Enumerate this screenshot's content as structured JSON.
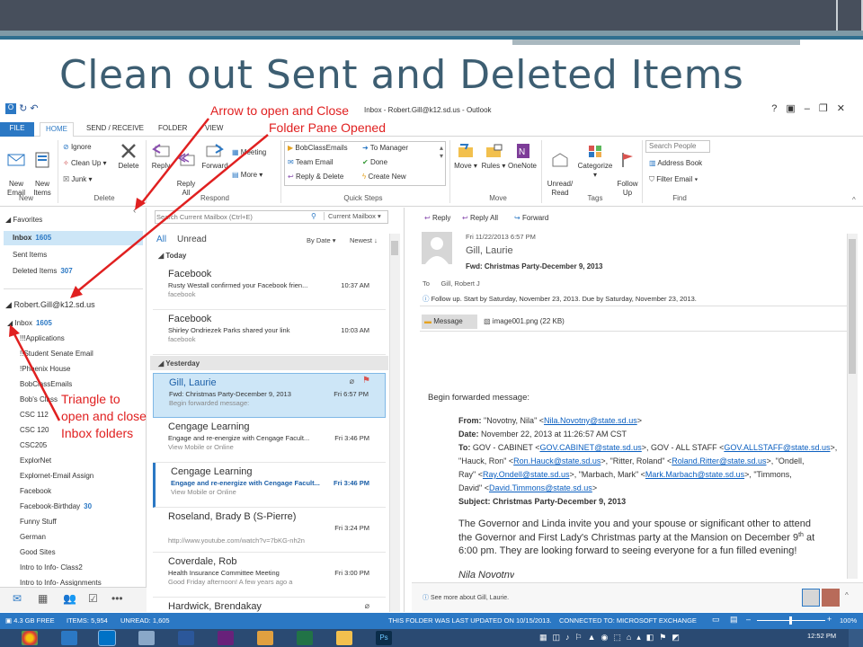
{
  "slide": {
    "title": "Clean out Sent and Deleted Items"
  },
  "window": {
    "title": "Inbox - Robert.Gill@k12.sd.us - Outlook"
  },
  "tabs": [
    "FILE",
    "HOME",
    "SEND / RECEIVE",
    "FOLDER",
    "VIEW"
  ],
  "ribbon": {
    "new_email": "New\nEmail",
    "new_items": "New\nItems",
    "ignore": "Ignore",
    "clean_up": "Clean Up",
    "junk": "Junk",
    "delete": "Delete",
    "reply": "Reply",
    "reply_all": "Reply\nAll",
    "forward": "Forward",
    "meeting": "Meeting",
    "more": "More",
    "qs_bobclass": "BobClassEmails",
    "qs_team": "Team Email",
    "qs_replydelete": "Reply & Delete",
    "qs_manager": "To Manager",
    "qs_done": "Done",
    "qs_createnew": "Create New",
    "move": "Move",
    "rules": "Rules",
    "onenote": "OneNote",
    "unread_read": "Unread/\nRead",
    "categorize": "Categorize",
    "follow_up": "Follow\nUp",
    "search_people": "Search People",
    "address_book": "Address Book",
    "filter_email": "Filter Email",
    "groups": [
      "New",
      "Delete",
      "Respond",
      "Quick Steps",
      "Move",
      "Tags",
      "Find"
    ]
  },
  "folders": {
    "favorites_label": "Favorites",
    "fav_inbox": "Inbox",
    "fav_inbox_count": "1605",
    "sent": "Sent Items",
    "deleted": "Deleted Items",
    "deleted_count": "307",
    "account": "Robert.Gill@k12.sd.us",
    "inbox": "Inbox",
    "inbox_count": "1605",
    "subfolders": [
      "!!!Applications",
      "!!Student Senate Email",
      "!Phoenix House",
      "BobClassEmails",
      "Bob's Class",
      "CSC 112",
      "CSC 120",
      "CSC205",
      "ExplorNet",
      "Explornet-Email Assign",
      "Facebook",
      "Facebook-Birthday",
      "Funny Stuff",
      "German",
      "Good Sites",
      "Intro to Info- Class2",
      "Intro to Info- Assignments"
    ],
    "fb_birthday_count": "30"
  },
  "list": {
    "search_placeholder": "Search Current Mailbox (Ctrl+E)",
    "scope": "Current Mailbox",
    "all": "All",
    "unread": "Unread",
    "by_date": "By Date",
    "newest": "Newest",
    "today": "Today",
    "yesterday": "Yesterday",
    "messages": [
      {
        "sender": "Facebook",
        "subject": "Rusty Westall confirmed your Facebook frien...",
        "preview": "facebook",
        "time": "10:37 AM"
      },
      {
        "sender": "Facebook",
        "subject": "Shirley Ondriezek Parks shared your link",
        "preview": "facebook",
        "time": "10:03 AM"
      },
      {
        "sender": "Gill, Laurie",
        "subject": "Fwd: Christmas Party-December 9, 2013",
        "preview": "Begin forwarded message:",
        "time": "Fri 6:57 PM"
      },
      {
        "sender": "Cengage Learning",
        "subject": "Engage and re-energize with Cengage Facult...",
        "preview": "View Mobile or Online",
        "time": "Fri 3:46 PM"
      },
      {
        "sender": "Cengage Learning",
        "subject": "Engage and re-energize with Cengage Facult...",
        "preview": "View Mobile or Online",
        "time": "Fri 3:46 PM"
      },
      {
        "sender": "Roseland, Brady B (S-Pierre)",
        "subject": "",
        "preview": "http://www.youtube.com/watch?v=7bKG-nh2n",
        "time": "Fri 3:24 PM"
      },
      {
        "sender": "Coverdale, Rob",
        "subject": "Health Insurance Committee Meeting",
        "preview": "Good Friday afternoon!  A few years ago a",
        "time": "Fri 3:00 PM"
      },
      {
        "sender": "Hardwick, Brendakay",
        "subject": "",
        "preview": "",
        "time": ""
      }
    ]
  },
  "reading": {
    "reply": "Reply",
    "reply_all": "Reply All",
    "forward": "Forward",
    "date": "Fri 11/22/2013 6:57 PM",
    "from": "Gill, Laurie",
    "subject": "Fwd: Christmas Party-December 9, 2013",
    "to_label": "To",
    "to": "Gill, Robert J",
    "followup": "Follow up.  Start by Saturday, November 23, 2013.  Due by Saturday, November 23, 2013.",
    "att_message": "Message",
    "att_image": "image001.png (22 KB)",
    "begin": "Begin forwarded message:",
    "fwd_from_label": "From:",
    "fwd_from_name": "\"Novotny, Nila\" <",
    "fwd_from_email": "Nila.Novotny@state.sd.us",
    "fwd_date_label": "Date:",
    "fwd_date": "November 22, 2013 at 11:26:57 AM CST",
    "fwd_to_label": "To:",
    "to_line1_a": "GOV - CABINET <",
    "to_line1_l1": "GOV.CABINET@state.sd.us",
    "to_line1_b": ">, GOV - ALL STAFF <",
    "to_line1_l2": "GOV.ALLSTAFF@state.sd.us",
    "to_line1_c": ">,",
    "to_line2_a": "\"Hauck, Ron\" <",
    "to_line2_l1": "Ron.Hauck@state.sd.us",
    "to_line2_b": ">, \"Ritter, Roland\" <",
    "to_line2_l2": "Roland.Ritter@state.sd.us",
    "to_line2_c": ">, \"Ondell,",
    "to_line3_a": "Ray\" <",
    "to_line3_l1": "Ray.Ondell@state.sd.us",
    "to_line3_b": ">, \"Marbach, Mark\" <",
    "to_line3_l2": "Mark.Marbach@state.sd.us",
    "to_line3_c": ">, \"Timmons,",
    "to_line4_a": "David\" <",
    "to_line4_l1": "David.Timmons@state.sd.us",
    "to_line4_c": ">",
    "fwd_subject_label": "Subject:",
    "fwd_subject": "Christmas Party-December 9, 2013",
    "body1": "The Governor and Linda invite you and your spouse or significant other to attend",
    "body2": "the Governor and First Lady's Christmas party at the Mansion on December 9",
    "body2_sup": "th",
    "body2_end": " at",
    "body3": "6:00 pm.  They are looking forward to seeing everyone for a fun filled evening!",
    "signature": "Nila Novotny",
    "people": "See more about Gill, Laurie."
  },
  "status": {
    "free": "4.3 GB FREE",
    "items": "ITEMS: 5,954",
    "unread": "UNREAD: 1,605",
    "updated": "THIS FOLDER WAS LAST UPDATED ON 10/15/2013.",
    "connected": "CONNECTED TO: MICROSOFT EXCHANGE",
    "zoom": "100%"
  },
  "taskbar": {
    "time": "12:52 PM"
  },
  "annotations": {
    "arrow_label": "Arrow to open and Close",
    "folder_label": "Folder Pane Opened",
    "tri1": "Triangle to",
    "tri2": "open and close",
    "tri3": "Inbox folders"
  },
  "colors": {
    "accent": "#2b78c4",
    "annotation": "#e02020",
    "title": "#3d5e72"
  }
}
